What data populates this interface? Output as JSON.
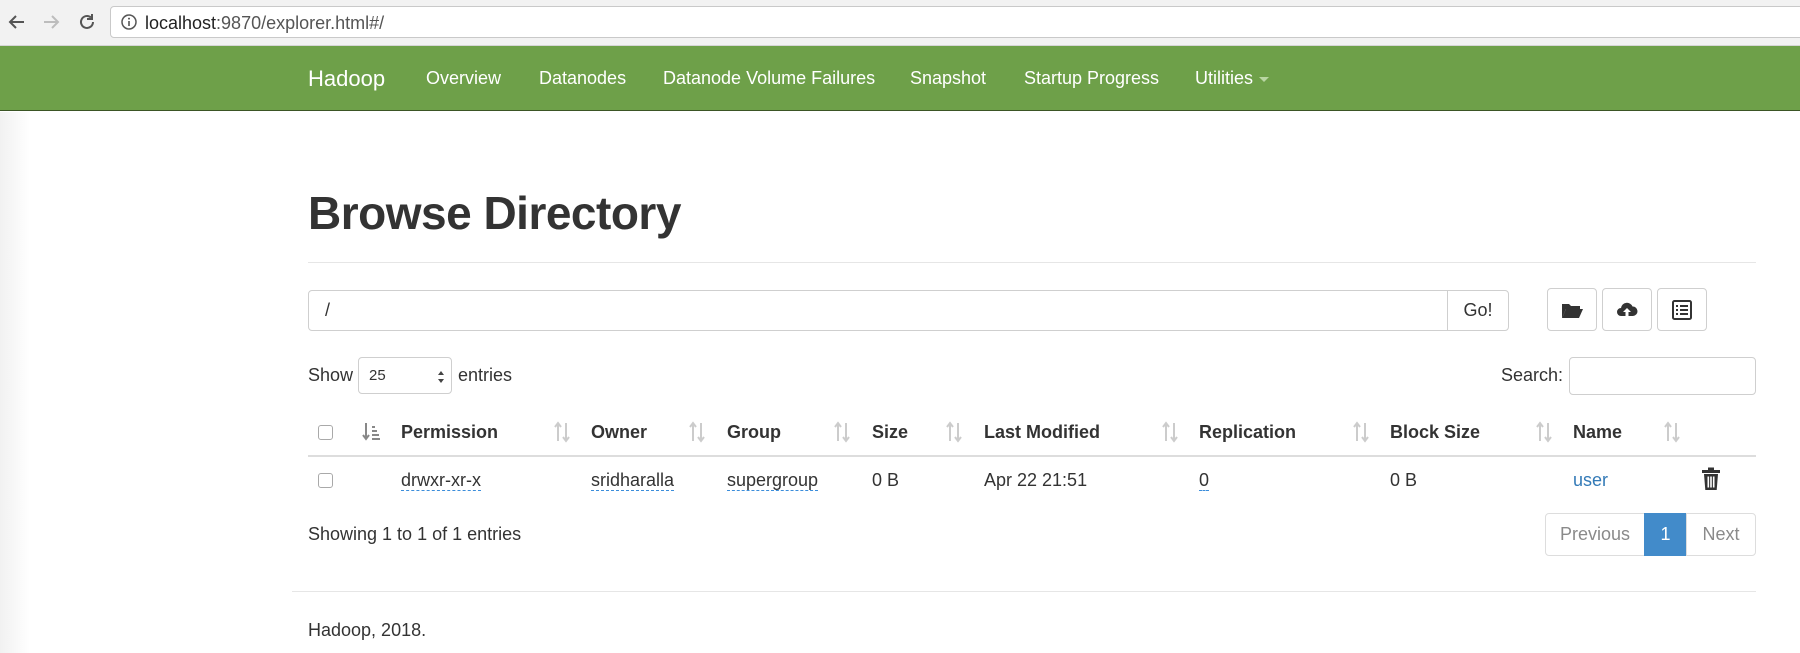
{
  "browser": {
    "url_host": "localhost",
    "url_rest": ":9870/explorer.html#/"
  },
  "navbar": {
    "brand": "Hadoop",
    "links": [
      "Overview",
      "Datanodes",
      "Datanode Volume Failures",
      "Snapshot",
      "Startup Progress",
      "Utilities"
    ]
  },
  "page": {
    "title": "Browse Directory"
  },
  "path_bar": {
    "value": "/",
    "go_label": "Go!"
  },
  "toolbar": {
    "icons": [
      "folder-open-icon",
      "cloud-upload-icon",
      "list-alt-icon"
    ]
  },
  "table_controls": {
    "show_label": "Show",
    "entries_value": "25",
    "entries_label": "entries",
    "search_label": "Search:"
  },
  "table": {
    "headers": [
      "Permission",
      "Owner",
      "Group",
      "Size",
      "Last Modified",
      "Replication",
      "Block Size",
      "Name"
    ],
    "rows": [
      {
        "permission": "drwxr-xr-x",
        "owner": "sridharalla",
        "group": "supergroup",
        "size": "0 B",
        "last_modified": "Apr 22 21:51",
        "replication": "0",
        "block_size": "0 B",
        "name": "user"
      }
    ]
  },
  "pagination": {
    "summary": "Showing 1 to 1 of 1 entries",
    "previous": "Previous",
    "current": "1",
    "next": "Next"
  },
  "footer": {
    "text": "Hadoop, 2018."
  },
  "colors": {
    "navbar": "#6ea049",
    "link": "#337ab7",
    "pager_active": "#428bca"
  }
}
